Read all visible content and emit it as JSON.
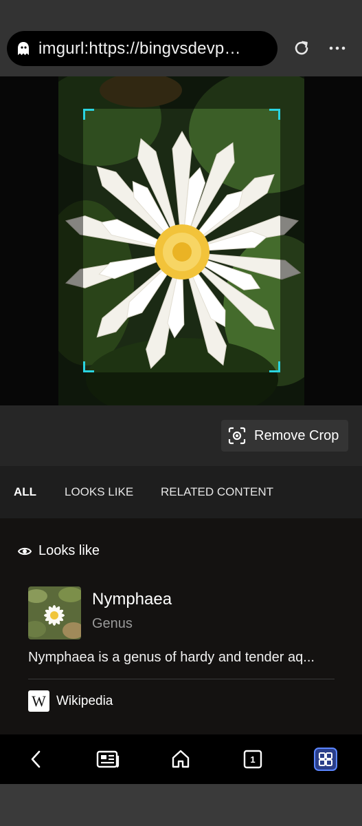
{
  "address_bar": {
    "url": "imgurl:https://bingvsdevp…"
  },
  "crop": {
    "remove_label": "Remove Crop"
  },
  "tabs": [
    {
      "label": "ALL",
      "active": true
    },
    {
      "label": "LOOKS LIKE",
      "active": false
    },
    {
      "label": "RELATED CONTENT",
      "active": false
    }
  ],
  "looks_like": {
    "heading": "Looks like",
    "entity": {
      "name": "Nymphaea",
      "type": "Genus",
      "description": "Nymphaea is a genus of hardy and tender aq...",
      "source": "Wikipedia"
    }
  },
  "bottom_nav": {
    "tab_count": "1",
    "items": [
      "back-icon",
      "news-icon",
      "home-icon",
      "tabs-icon",
      "apps-icon"
    ]
  },
  "colors": {
    "crop_accent": "#2ad4e0",
    "apps_accent": "#4a7cf0"
  }
}
